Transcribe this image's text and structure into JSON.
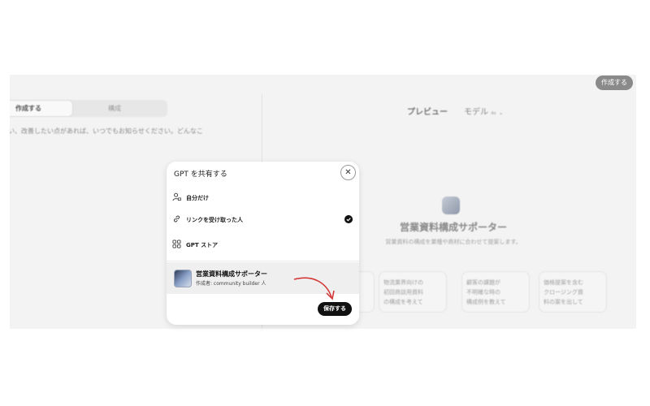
{
  "header": {
    "create_button": "作成する"
  },
  "editor": {
    "tabs": [
      "作成する",
      "構成"
    ],
    "message": "い、改善したい点があれば、いつでもお知らせください。どんなこ"
  },
  "preview": {
    "title": "プレビュー",
    "model_label": "モデル",
    "model_value": "4o",
    "gpt_name": "営業資料構成サポーター",
    "gpt_description": "営業資料の構成を業種や商材に合わせて提案します。",
    "conversation_starters": [
      "",
      "物流業界向けの\n初回商談用資料\nの構成を考えて",
      "顧客の課題が\n不明確な時の\n構成例を教えて",
      "価格提案を含む\nクロージング資\n料の案を出して"
    ]
  },
  "share_dialog": {
    "title": "GPT を共有する",
    "close_icon": "close-icon",
    "options": [
      {
        "label": "自分だけ",
        "icon": "person-lock-icon",
        "selected": false
      },
      {
        "label": "リンクを受け取った人",
        "icon": "link-icon",
        "selected": true
      },
      {
        "label": "GPT ストア",
        "icon": "grid-icon",
        "selected": false
      }
    ],
    "gpt_card": {
      "name": "営業資料構成サポーター",
      "author": "作成者: community builder 人"
    },
    "save_button": "保存する"
  },
  "annotation": {
    "arrow_color": "#d32f2f"
  }
}
